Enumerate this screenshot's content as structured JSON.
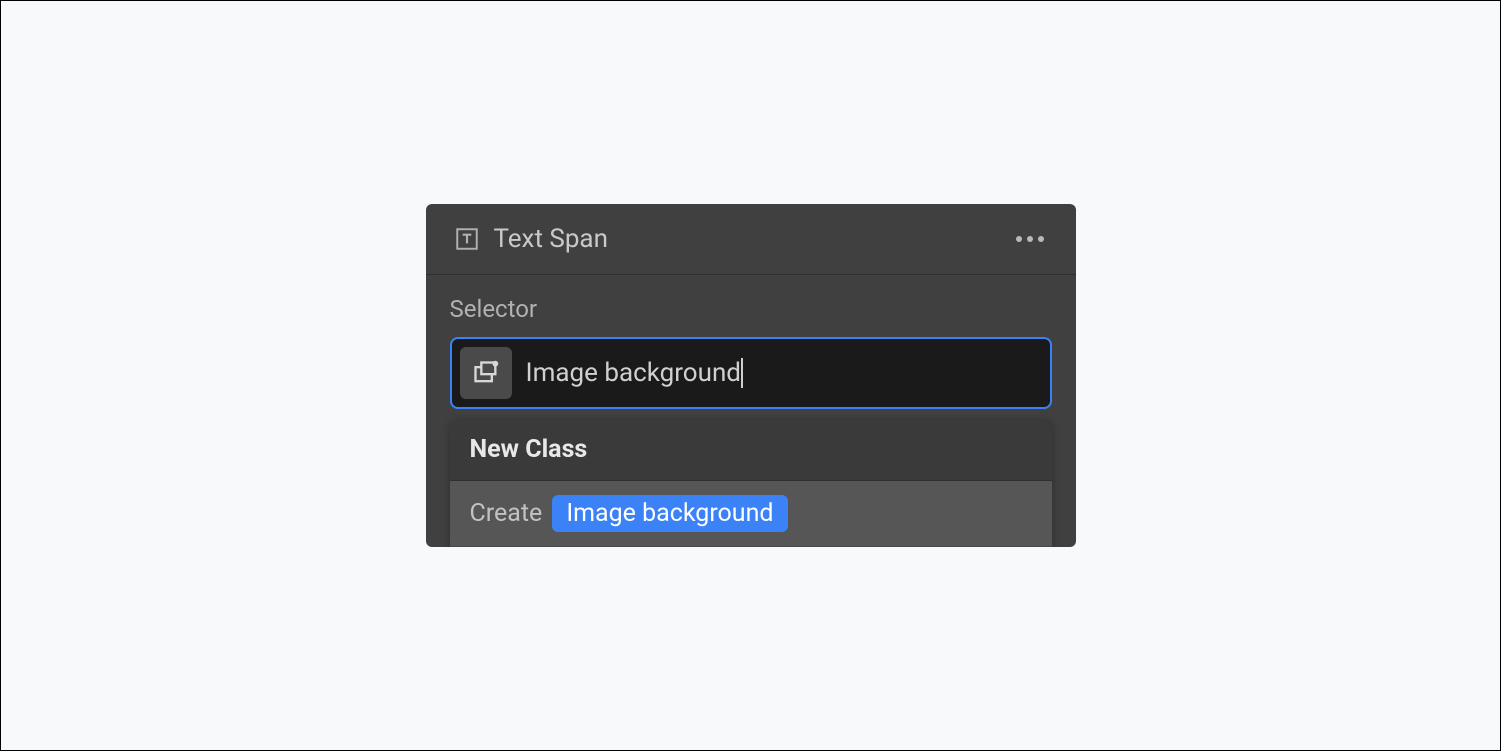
{
  "header": {
    "element_label": "Text Span"
  },
  "selector": {
    "label": "Selector",
    "input_value": "Image background"
  },
  "dropdown": {
    "section_title": "New Class",
    "create_prefix": "Create",
    "create_class_name": "Image background"
  }
}
